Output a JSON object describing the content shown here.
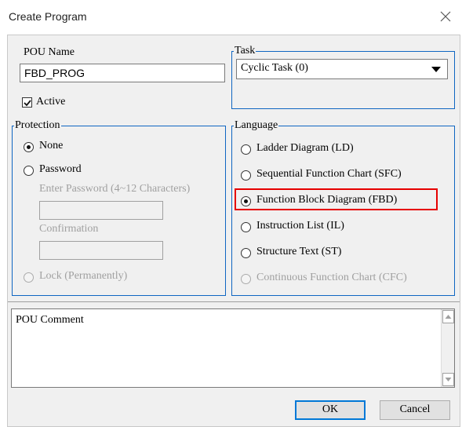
{
  "window": {
    "title": "Create Program"
  },
  "pou": {
    "name_label": "POU Name",
    "name_value": "FBD_PROG",
    "active_label": "Active",
    "active_checked": true
  },
  "task": {
    "group_label": "Task",
    "selected": "Cyclic Task (0)"
  },
  "protection": {
    "group_label": "Protection",
    "none_label": "None",
    "password_label": "Password",
    "enter_password_label": "Enter Password (4~12 Characters)",
    "confirmation_label": "Confirmation",
    "lock_label": "Lock (Permanently)",
    "selected": "None"
  },
  "language": {
    "group_label": "Language",
    "options": [
      {
        "label": "Ladder Diagram (LD)",
        "checked": false,
        "enabled": true
      },
      {
        "label": "Sequential Function Chart (SFC)",
        "checked": false,
        "enabled": true
      },
      {
        "label": "Function Block Diagram (FBD)",
        "checked": true,
        "enabled": true
      },
      {
        "label": "Instruction List (IL)",
        "checked": false,
        "enabled": true
      },
      {
        "label": "Structure Text (ST)",
        "checked": false,
        "enabled": true
      },
      {
        "label": "Continuous Function Chart (CFC)",
        "checked": false,
        "enabled": false
      }
    ],
    "highlight_color": "#e60000"
  },
  "comment": {
    "text": "POU Comment"
  },
  "buttons": {
    "ok_label": "OK",
    "cancel_label": "Cancel"
  },
  "colors": {
    "group_border": "#0f66c2",
    "dialog_bg": "#f0f0f0"
  }
}
